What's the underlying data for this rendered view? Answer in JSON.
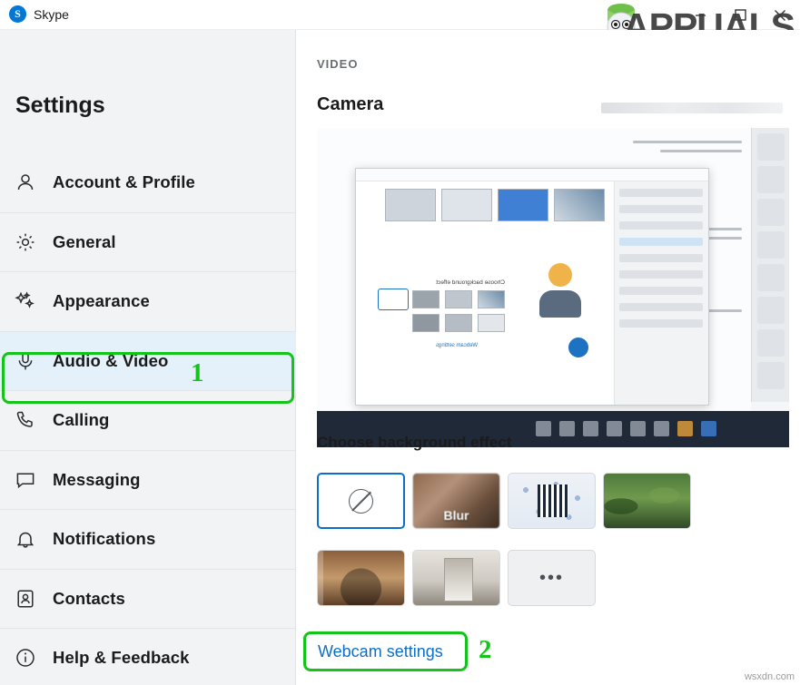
{
  "window": {
    "app_title": "Skype",
    "logo_letter": "S",
    "controls": {
      "minimize": "minimize-button",
      "maximize": "maximize-button",
      "close": "close-button"
    }
  },
  "watermark": {
    "text": "APPUALS"
  },
  "sidebar": {
    "heading": "Settings",
    "items": [
      {
        "label": "Account & Profile",
        "icon": "person-icon",
        "selected": false
      },
      {
        "label": "General",
        "icon": "gear-icon",
        "selected": false
      },
      {
        "label": "Appearance",
        "icon": "sparkle-icon",
        "selected": false
      },
      {
        "label": "Audio & Video",
        "icon": "microphone-icon",
        "selected": true
      },
      {
        "label": "Calling",
        "icon": "phone-icon",
        "selected": false
      },
      {
        "label": "Messaging",
        "icon": "chat-icon",
        "selected": false
      },
      {
        "label": "Notifications",
        "icon": "bell-icon",
        "selected": false
      },
      {
        "label": "Contacts",
        "icon": "contacts-icon",
        "selected": false
      },
      {
        "label": "Help & Feedback",
        "icon": "info-icon",
        "selected": false
      }
    ]
  },
  "main": {
    "kicker": "VIDEO",
    "camera_heading": "Camera",
    "background_heading": "Choose background effect",
    "webcam_settings_link": "Webcam settings",
    "effects": [
      {
        "name": "none",
        "label": ""
      },
      {
        "name": "blur",
        "label": "Blur"
      },
      {
        "name": "pattern",
        "label": ""
      },
      {
        "name": "plants",
        "label": ""
      },
      {
        "name": "office",
        "label": ""
      },
      {
        "name": "room",
        "label": ""
      },
      {
        "name": "more",
        "label": "•••"
      }
    ]
  },
  "annotations": {
    "step_one": "1",
    "step_two": "2",
    "highlight_color": "#15c41b"
  },
  "footer": {
    "credit": "wsxdn.com"
  }
}
